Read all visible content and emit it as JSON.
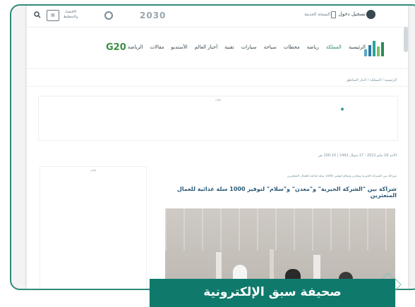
{
  "topbar": {
    "vision_text": "2030",
    "edition_label": "النسخة الحديثة",
    "login_label": "تسجيل دخول",
    "small_logo_text": "الاقتصاد والتخطيط"
  },
  "brand": {
    "g20": "G20"
  },
  "nav": {
    "items": [
      "الرئيسية",
      "المملكة",
      "رياضة",
      "محطات",
      "سياحة",
      "سيارات",
      "تقنية",
      "أخبار العالم",
      "الأستديو",
      "مقالات",
      "الرياضة"
    ]
  },
  "breadcrumb": "الرئيسية  /  المملكة  /  أخبار المناطق",
  "ad": {
    "label": "إعلان"
  },
  "meta": "الأحد 16 مايو 2021 - 17 شوال 1442  |  100:10 ص",
  "sidebar_ad": {
    "label": "إعلان"
  },
  "tags": "شراكة بين الشركة الخيرية ومعدن وسلام لتوفير 1000 سلة غذائية للعمال المتعثرين",
  "headline": "شراكة بين \"الشركة الخيرية\" و\"معدن\" و\"سلام\" لتوفير 1000 سلة غذائية للعمال المتعثرين",
  "caption": "صحيفة سبق الإلكترونية",
  "colors": {
    "frame": "#2f8a7a",
    "caption_bg": "#0f7a6c",
    "headline": "#2b5a76",
    "active_nav": "#2e8a5a"
  }
}
